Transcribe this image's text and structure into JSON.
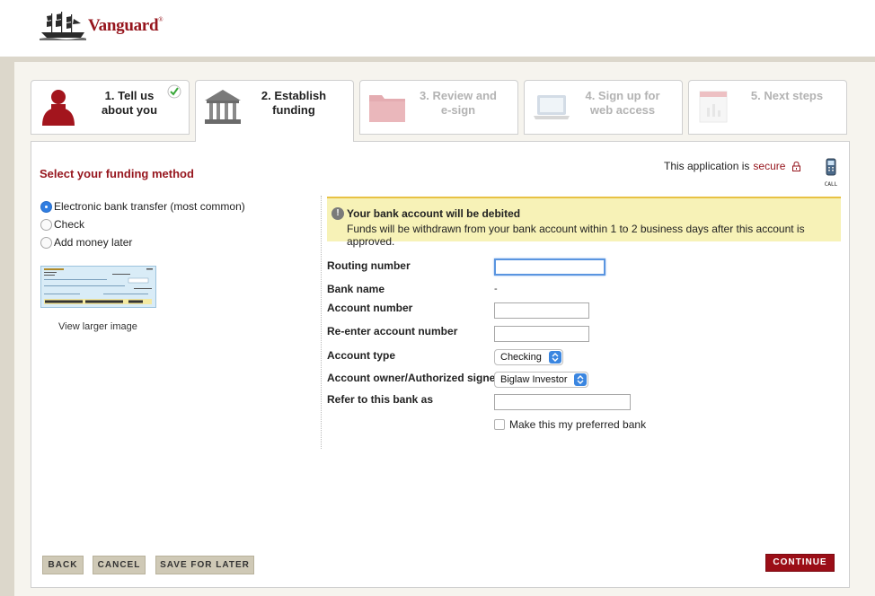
{
  "header": {
    "brand": "Vanguard",
    "registered": "®"
  },
  "steps": [
    {
      "number_label": "1. Tell us about you",
      "line1": "1. Tell us",
      "line2": "about you",
      "state": "completed"
    },
    {
      "number_label": "2. Establish funding",
      "line1": "2. Establish",
      "line2": "funding",
      "state": "active"
    },
    {
      "number_label": "3. Review and e-sign",
      "line1": "3. Review and",
      "line2": "e-sign",
      "state": "disabled"
    },
    {
      "number_label": "4. Sign up for web access",
      "line1": "4. Sign up for",
      "line2": "web access",
      "state": "disabled"
    },
    {
      "number_label": "5. Next steps",
      "line1": "5. Next steps",
      "line2": "",
      "state": "disabled"
    }
  ],
  "main": {
    "section_title": "Select your funding method",
    "secure_prefix": "This application is",
    "secure_link": "secure",
    "call_label": "CALL",
    "funding_methods": [
      {
        "label": "Electronic bank transfer (most common)",
        "selected": true
      },
      {
        "label": "Check",
        "selected": false
      },
      {
        "label": "Add money later",
        "selected": false
      }
    ],
    "view_larger": "View larger image",
    "alert": {
      "icon": "!",
      "title": "Your bank account will be debited",
      "body": "Funds will be withdrawn from your bank account within 1 to 2 business days after this account is approved."
    },
    "form": {
      "routing_label": "Routing number",
      "routing_value": "",
      "bank_name_label": "Bank name",
      "bank_name_value": "-",
      "account_label": "Account number",
      "account_value": "",
      "reenter_label": "Re-enter account number",
      "reenter_value": "",
      "account_type_label": "Account type",
      "account_type_value": "Checking",
      "owner_label": "Account owner/Authorized signer",
      "owner_value": "Biglaw Investor",
      "nickname_label": "Refer to this bank as",
      "nickname_value": "",
      "preferred_label": "Make this my preferred bank",
      "preferred_checked": false
    }
  },
  "footer": {
    "back": "BACK",
    "cancel": "CANCEL",
    "save_later": "SAVE FOR LATER",
    "continue": "CONTINUE"
  },
  "colors": {
    "brand_red": "#96151d",
    "alert_bg": "#f7f2b7",
    "alert_border": "#e8c244",
    "button_tan": "#cfc9b6",
    "continue_red": "#9b0e17",
    "page_bg": "#dcd7cb"
  }
}
